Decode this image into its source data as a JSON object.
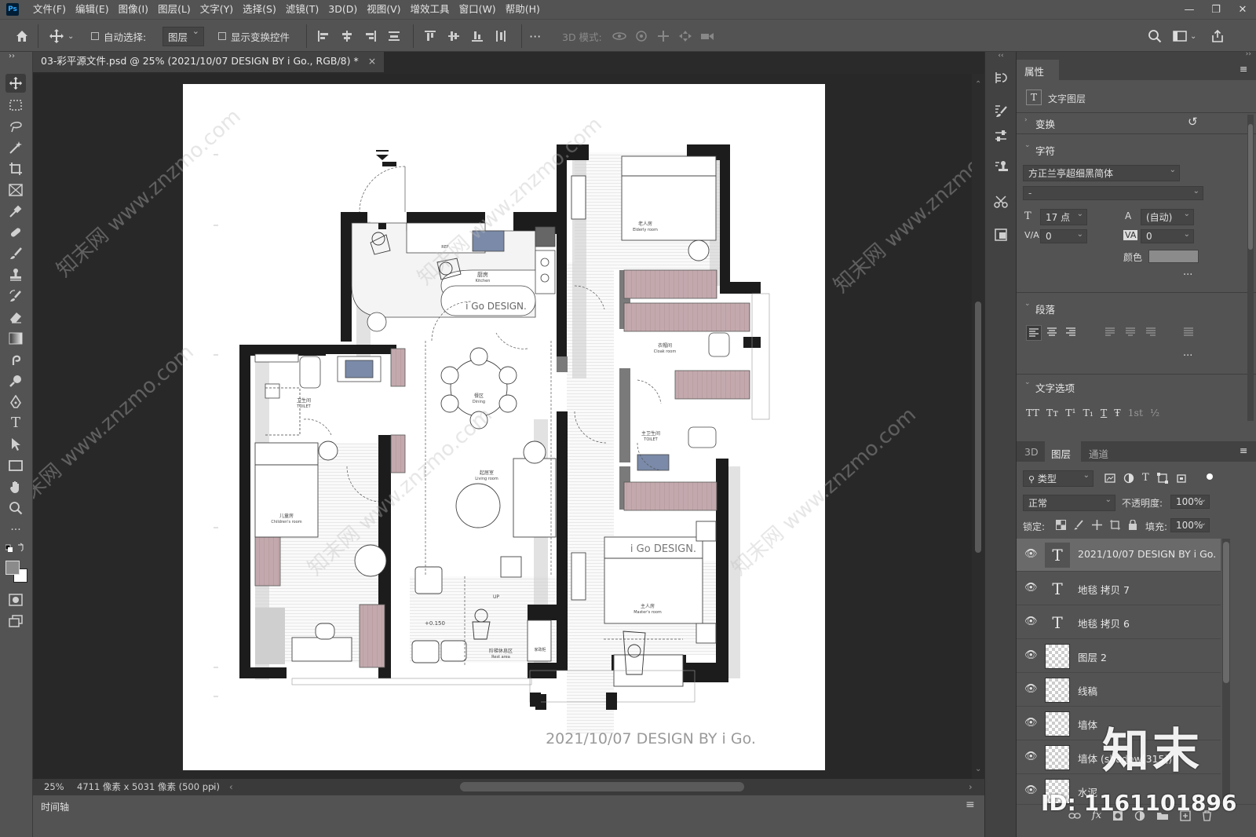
{
  "app": {
    "logo": "Ps"
  },
  "menu": [
    "文件(F)",
    "编辑(E)",
    "图像(I)",
    "图层(L)",
    "文字(Y)",
    "选择(S)",
    "滤镜(T)",
    "3D(D)",
    "视图(V)",
    "增效工具",
    "窗口(W)",
    "帮助(H)"
  ],
  "window_controls": {
    "minimize": "—",
    "restore": "❐",
    "close": "✕"
  },
  "options": {
    "auto_select_label": "自动选择:",
    "auto_select_value": "图层",
    "show_transform_label": "显示变换控件",
    "more": "···",
    "mode_3d_label": "3D 模式:"
  },
  "document": {
    "tab_title": "03-彩平源文件.psd @ 25% (2021/10/07 DESIGN BY i Go., RGB/8) *",
    "close": "×"
  },
  "status": {
    "zoom": "25%",
    "doc_info": "4711 像素 x 5031 像素 (500 ppi)"
  },
  "timeline": {
    "label": "时间轴"
  },
  "floorplan": {
    "kitchen": "厨房",
    "kitchen_en": "Kitchen",
    "brand_kitchen": "i Go DESIGN.",
    "fridge": "REF",
    "dining": "餐区",
    "dining_en": "Dining",
    "living": "起居室",
    "living_en": "Living room",
    "elderly": "老人房",
    "elderly_en": "Elderly room",
    "cloak": "衣帽间",
    "cloak_en": "Cloak room",
    "main_toilet": "主卫生间",
    "main_toilet_en": "TOILET",
    "master": "主人房",
    "master_en": "Master's room",
    "brand_master": "i Go DESIGN.",
    "toilet": "卫生间",
    "toilet_en": "TOILET",
    "children": "儿童房",
    "children_en": "Children's room",
    "rest": "阶梯休息区",
    "rest_en": "Rest area",
    "level": "+0.150",
    "up": "UP",
    "laundry": "家政柜",
    "signature": "2021/10/07 DESIGN BY i Go.",
    "watermark": "知末网 www.znzmo.com"
  },
  "properties": {
    "tab": "属性",
    "type_layer": "文字图层",
    "transform": "变换",
    "character": "字符",
    "font_family": "方正兰亭超细黑简体",
    "font_style": "-",
    "font_size": "17 点",
    "leading": "(自动)",
    "tracking_va": "0",
    "kerning": "0",
    "color_label": "颜色",
    "more": "···",
    "paragraph": "段落",
    "type_options": "文字选项",
    "type_opt_glyphs": [
      "TT",
      "Tт",
      "T¹",
      "T₁",
      "T",
      "Ŧ",
      "1st",
      "½"
    ]
  },
  "layers_panel": {
    "tabs": [
      "3D",
      "图层",
      "通道"
    ],
    "filter_kind": "类型",
    "blend_mode": "正常",
    "opacity_label": "不透明度:",
    "opacity_value": "100%",
    "lock_label": "锁定:",
    "fill_label": "填充:",
    "fill_value": "100%",
    "layers": [
      {
        "name": "2021/10/07 DESIGN BY i Go.",
        "type": "text"
      },
      {
        "name": "地毯 拷贝 7",
        "type": "text"
      },
      {
        "name": "地毯 拷贝 6",
        "type": "text"
      },
      {
        "name": "图层 2",
        "type": "pixel"
      },
      {
        "name": "线稿",
        "type": "pixel"
      },
      {
        "name": "墙体",
        "type": "pixel"
      },
      {
        "name": "墙体 (shadow[315])",
        "type": "pixel"
      },
      {
        "name": "水泥",
        "type": "pixel"
      }
    ],
    "footer_icons": [
      "link-icon",
      "fx",
      "mask-icon",
      "adjustment-icon",
      "folder-icon",
      "new-layer-icon",
      "trash-icon"
    ],
    "fx_label": "fx"
  },
  "overlay_watermark": {
    "brand": "知末",
    "id": "ID: 1161101896"
  },
  "colors": {
    "chrome": "#535353",
    "canvas_bg": "#282828",
    "wall": "#1c1c1c",
    "mauve": "#b9a2a6",
    "blue": "#7183a6"
  }
}
